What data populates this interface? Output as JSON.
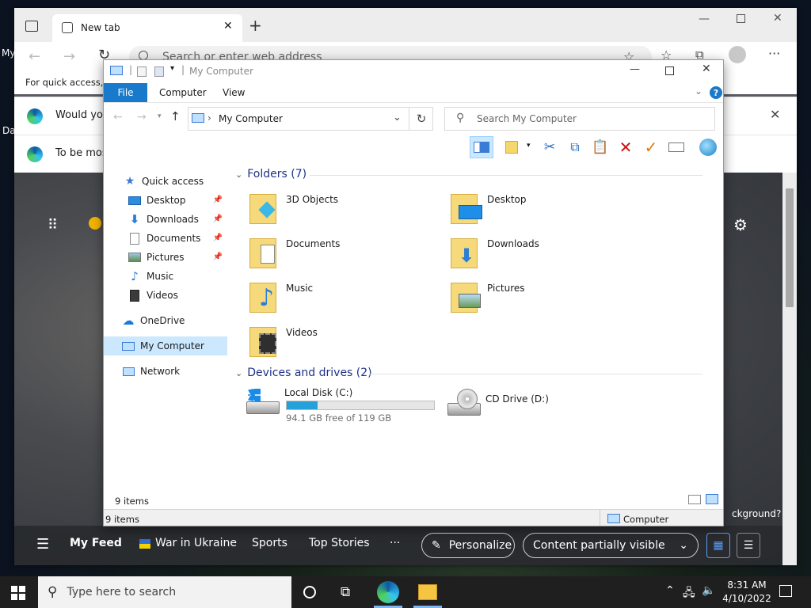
{
  "desktop": {
    "left_labels": [
      "My",
      "Da"
    ],
    "hint_text": "ckground?"
  },
  "browser": {
    "tab_title": "New tab",
    "address_placeholder": "Search or enter web address",
    "quick_access_text": "For quick access, p",
    "info_bar_1": "Would you",
    "info_bar_2": "To be mos",
    "feed": {
      "items": [
        "My Feed",
        "War in Ukraine",
        "Sports",
        "Top Stories"
      ],
      "more": "···",
      "personalize": "Personalize",
      "content_visibility": "Content partially visible"
    }
  },
  "explorer": {
    "title": "My Computer",
    "ribbon_tabs": [
      "File",
      "Computer",
      "View"
    ],
    "path": "My Computer",
    "search_placeholder": "Search My Computer",
    "nav": {
      "quick_access": "Quick access",
      "pinned": [
        {
          "label": "Desktop",
          "pinned": true,
          "icon": "desktop-icon"
        },
        {
          "label": "Downloads",
          "pinned": true,
          "icon": "downloads-icon"
        },
        {
          "label": "Documents",
          "pinned": true,
          "icon": "documents-icon"
        },
        {
          "label": "Pictures",
          "pinned": true,
          "icon": "pictures-icon"
        },
        {
          "label": "Music",
          "pinned": false,
          "icon": "music-icon"
        },
        {
          "label": "Videos",
          "pinned": false,
          "icon": "videos-icon"
        }
      ],
      "onedrive": "OneDrive",
      "my_computer": "My Computer",
      "network": "Network"
    },
    "folders_group": "Folders (7)",
    "folders": [
      "3D Objects",
      "Desktop",
      "Documents",
      "Downloads",
      "Music",
      "Pictures",
      "Videos"
    ],
    "drives_group": "Devices and drives (2)",
    "drives": [
      {
        "name": "Local Disk (C:)",
        "free_text": "94.1 GB free of 119 GB",
        "used_fraction": 0.21
      },
      {
        "name": "CD Drive (D:)"
      }
    ],
    "status_count": "9 items",
    "status_count_bottom": "9 items",
    "status_location": "Computer"
  },
  "taskbar": {
    "search_placeholder": "Type here to search",
    "time": "8:31 AM",
    "date": "4/10/2022"
  },
  "colors": {
    "accent": "#1979ca",
    "group_title": "#1e3287",
    "selected_nav": "#cce8ff",
    "drive_bar": "#26a0da"
  }
}
